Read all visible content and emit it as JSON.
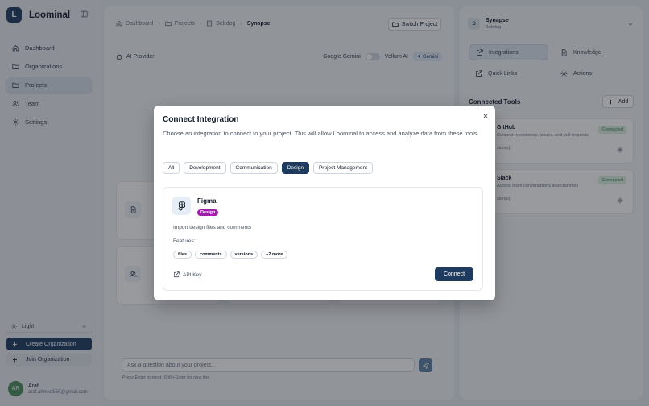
{
  "app": {
    "logo_letter": "L",
    "name": "Loominal"
  },
  "sidebar": {
    "items": [
      {
        "label": "Dashboard",
        "icon": "home-icon"
      },
      {
        "label": "Organizations",
        "icon": "folder-icon"
      },
      {
        "label": "Projects",
        "icon": "folder-icon",
        "active": true
      },
      {
        "label": "Team",
        "icon": "users-icon"
      },
      {
        "label": "Settings",
        "icon": "gear-icon"
      }
    ],
    "theme": "Light",
    "create_org": "Create Organization",
    "join_org": "Join Organization",
    "user": {
      "initials": "AR",
      "name": "Araf",
      "email": "araf.ahmed556@gmail.com"
    }
  },
  "main": {
    "breadcrumb": [
      "Dashboard",
      "Projects",
      "Bebdog",
      "Synapse"
    ],
    "switch_project": "Switch Project",
    "ai_provider_label": "AI Provider",
    "provider_option_a": "Google Gemini",
    "provider_option_b": "Vellum AI",
    "provider_badge": "Gemini",
    "chat_placeholder": "Ask a question about your project...",
    "chat_hint": "Press Enter to send, Shift+Enter for new line"
  },
  "right_panel": {
    "project_letter": "S",
    "project_name": "Synapse",
    "org_name": "Bebdog",
    "tabs": [
      {
        "label": "Integrations",
        "icon": "external-link-icon",
        "active": true
      },
      {
        "label": "Knowledge",
        "icon": "document-icon"
      },
      {
        "label": "Quick Links",
        "icon": "external-link-icon"
      },
      {
        "label": "Actions",
        "icon": "gear-icon"
      }
    ],
    "tools_title": "Connected Tools",
    "add_label": "Add",
    "tools": [
      {
        "name": "GitHub",
        "description": "Connect repositories, issues, and pull requests",
        "meta": "sion(s)",
        "status": "Connected"
      },
      {
        "name": "Slack",
        "description": "Access team conversations and channels",
        "meta": "sion(s)",
        "status": "Connected"
      }
    ]
  },
  "modal": {
    "title": "Connect Integration",
    "description": "Choose an integration to connect to your project. This will allow Loominal to access and analyze data from these tools.",
    "filters": [
      "All",
      "Development",
      "Communication",
      "Design",
      "Project Management"
    ],
    "active_filter": "Design",
    "integration": {
      "name": "Figma",
      "category": "Design",
      "description": "Import design files and comments",
      "features_label": "Features:",
      "features": [
        "files",
        "comments",
        "versions",
        "+2 more"
      ],
      "auth": "API Key",
      "connect": "Connect"
    }
  },
  "colors": {
    "primary": "#1e3a5f",
    "category_badge": "#a21caf",
    "connected": "#2e7d4f"
  }
}
